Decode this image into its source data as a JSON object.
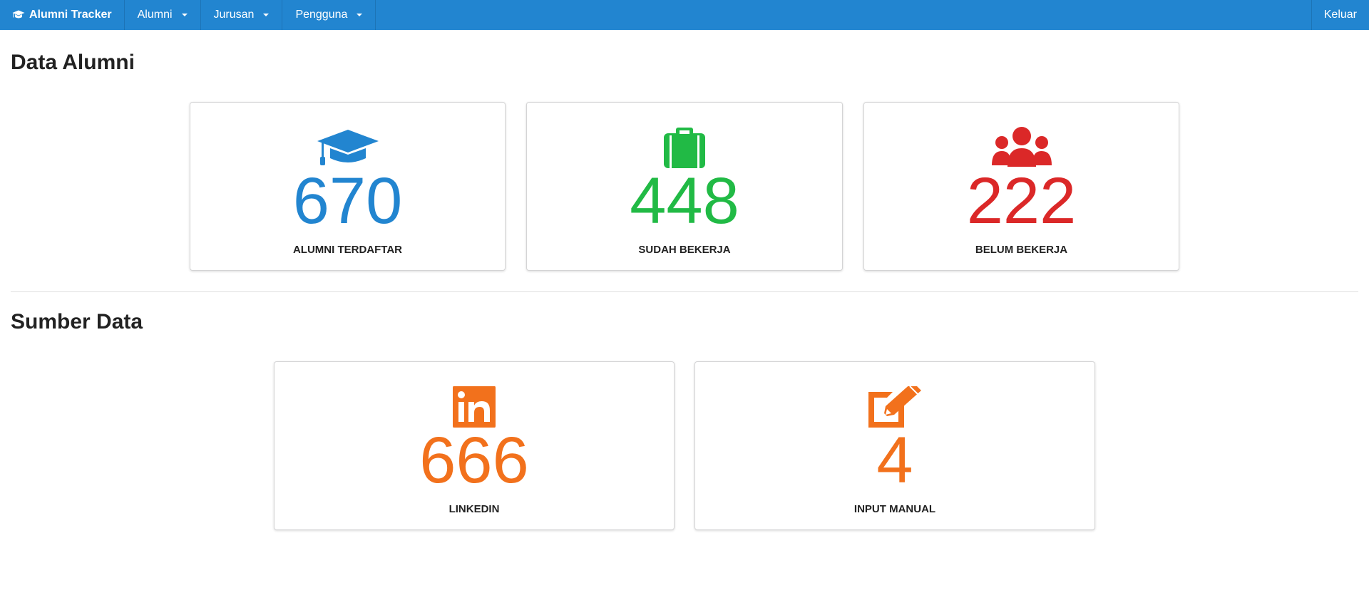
{
  "navbar": {
    "brand": "Alumni Tracker",
    "brand_icon": "graduation-cap-icon",
    "menus": [
      {
        "label": "Alumni"
      },
      {
        "label": "Jurusan"
      },
      {
        "label": "Pengguna"
      }
    ],
    "logout": "Keluar",
    "color": "#2285d0"
  },
  "sections": {
    "alumni": {
      "title": "Data Alumni",
      "cards": [
        {
          "icon": "graduation-cap-icon",
          "value": "670",
          "label": "ALUMNI TERDAFTAR",
          "color": "#2285d0"
        },
        {
          "icon": "briefcase-icon",
          "value": "448",
          "label": "SUDAH BEKERJA",
          "color": "#21ba45"
        },
        {
          "icon": "users-icon",
          "value": "222",
          "label": "BELUM BEKERJA",
          "color": "#db2828"
        }
      ]
    },
    "sources": {
      "title": "Sumber Data",
      "cards": [
        {
          "icon": "linkedin-icon",
          "value": "666",
          "label": "LINKEDIN",
          "color": "#f2711c"
        },
        {
          "icon": "edit-icon",
          "value": "4",
          "label": "INPUT MANUAL",
          "color": "#f2711c"
        }
      ]
    }
  }
}
